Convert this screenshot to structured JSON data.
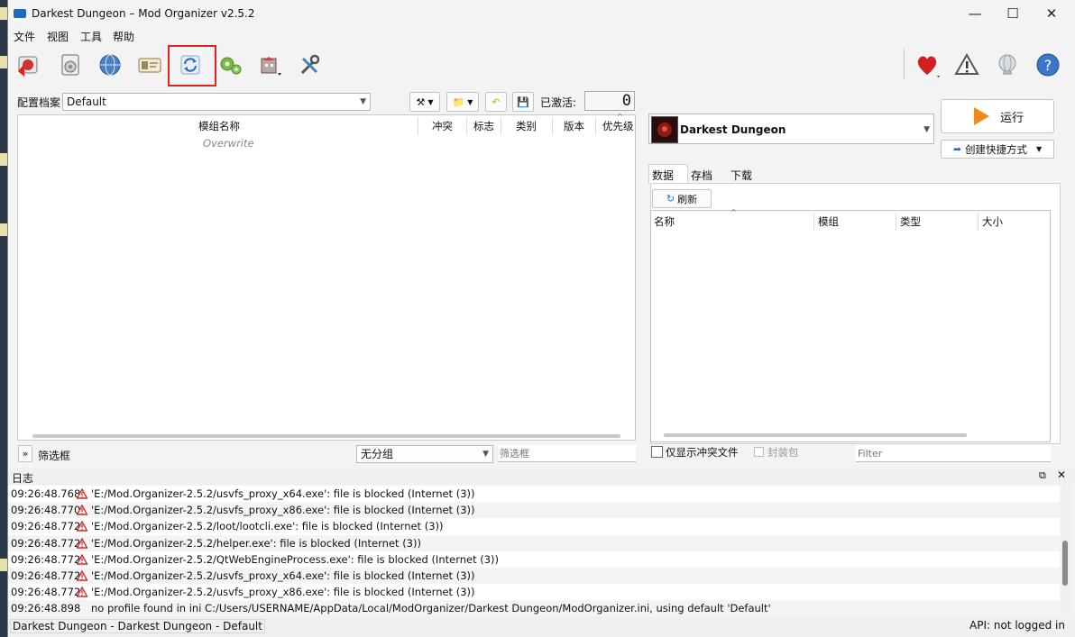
{
  "window": {
    "title": "Darkest Dungeon – Mod Organizer v2.5.2"
  },
  "menu": [
    "文件",
    "视图",
    "工具",
    "帮助"
  ],
  "toolbar": {
    "icons": [
      "change-instance-icon",
      "install-mod-icon",
      "nexus-icon",
      "profiles-icon",
      "refresh-icon",
      "executables-icon",
      "tools-icon",
      "settings-icon",
      "endorse-icon",
      "notifications-icon",
      "update-icon",
      "help-icon"
    ]
  },
  "profile": {
    "label": "配置档案",
    "value": "Default",
    "active_label": "已激活:",
    "active_count": "0"
  },
  "modlist": {
    "columns": [
      "模组名称",
      "冲突",
      "标志",
      "类别",
      "版本",
      "优先级"
    ],
    "rows": [
      "Overwrite"
    ]
  },
  "filterbar": {
    "toggle": "»",
    "label": "筛选框",
    "group_value": "无分组",
    "filter_placeholder": "筛选框"
  },
  "executable": {
    "name": "Darkest Dungeon",
    "run_label": "运行",
    "shortcut_label": "创建快捷方式"
  },
  "tabs": [
    "数据",
    "存档",
    "下载"
  ],
  "data": {
    "refresh_label": "刷新",
    "columns": [
      "名称",
      "模组",
      "类型",
      "大小"
    ],
    "conflicts_only_label": "仅显示冲突文件",
    "archives_label": "封装包",
    "filter_placeholder": "Filter"
  },
  "log": {
    "title": "日志",
    "rows": [
      {
        "time": "09:26:48.768",
        "msg": "'E:/Mod.Organizer-2.5.2/usvfs_proxy_x64.exe': file is blocked (Internet (3))"
      },
      {
        "time": "09:26:48.770",
        "msg": "'E:/Mod.Organizer-2.5.2/usvfs_proxy_x86.exe': file is blocked (Internet (3))"
      },
      {
        "time": "09:26:48.772",
        "msg": "'E:/Mod.Organizer-2.5.2/loot/lootcli.exe': file is blocked (Internet (3))"
      },
      {
        "time": "09:26:48.772",
        "msg": "'E:/Mod.Organizer-2.5.2/helper.exe': file is blocked (Internet (3))"
      },
      {
        "time": "09:26:48.772",
        "msg": "'E:/Mod.Organizer-2.5.2/QtWebEngineProcess.exe': file is blocked (Internet (3))"
      },
      {
        "time": "09:26:48.772",
        "msg": "'E:/Mod.Organizer-2.5.2/usvfs_proxy_x64.exe': file is blocked (Internet (3))"
      },
      {
        "time": "09:26:48.772",
        "msg": "'E:/Mod.Organizer-2.5.2/usvfs_proxy_x86.exe': file is blocked (Internet (3))"
      },
      {
        "time": "09:26:48.898",
        "msg": "no profile found in ini C:/Users/USERNAME/AppData/Local/ModOrganizer/Darkest Dungeon/ModOrganizer.ini, using default 'Default'"
      }
    ]
  },
  "status": {
    "left": "Darkest Dungeon - Darkest Dungeon - Default",
    "right": "API: not logged in"
  },
  "colors": {
    "highlight": "#e0241d",
    "warning": "#d22b2b",
    "run_accent": "#f08a1c"
  }
}
